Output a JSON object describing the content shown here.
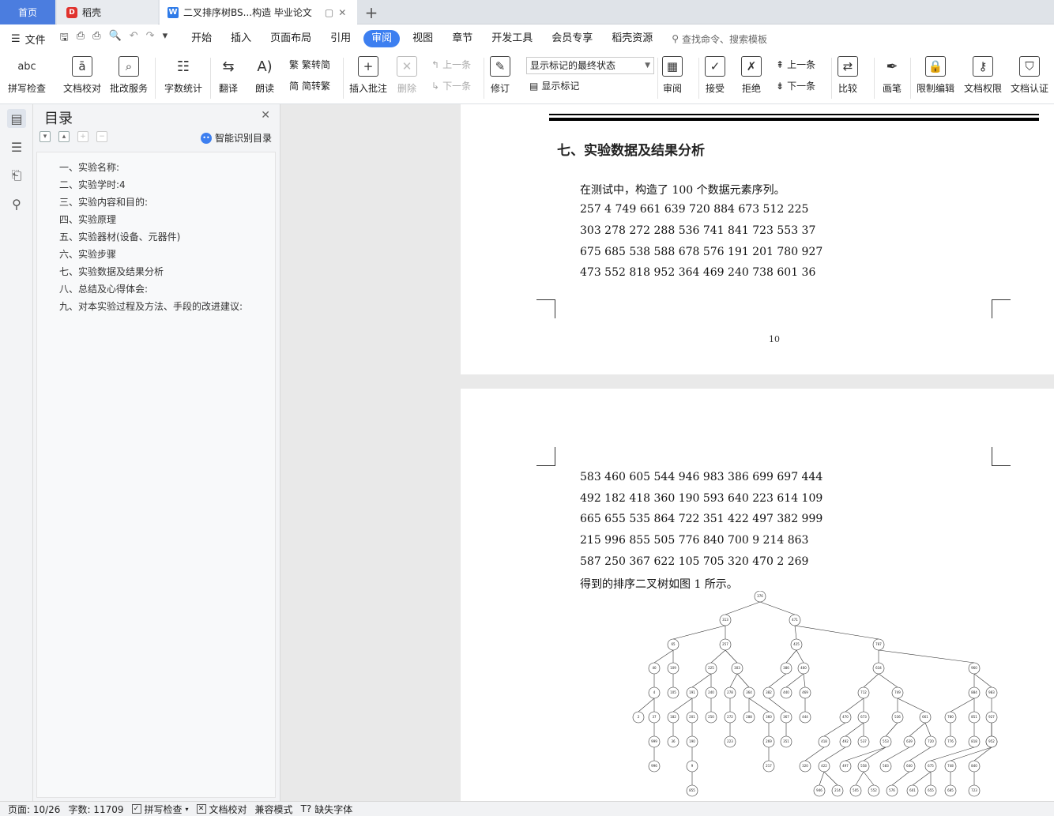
{
  "tabs": {
    "home": "首页",
    "daoke": "稻壳",
    "doc": "二叉排序树BS...构造 毕业论文"
  },
  "menubar": {
    "file": "文件",
    "items": [
      "开始",
      "插入",
      "页面布局",
      "引用",
      "审阅",
      "视图",
      "章节",
      "开发工具",
      "会员专享",
      "稻壳资源"
    ],
    "active": "审阅",
    "search": "查找命令、搜索模板"
  },
  "ribbon": {
    "spell": "拼写检查",
    "proof": "文档校对",
    "revise_service": "批改服务",
    "word_count": "字数统计",
    "translate": "翻译",
    "read_aloud": "朗读",
    "to_trad": "繁转简",
    "to_simp": "简转繁",
    "insert_comment": "插入批注",
    "delete": "删除",
    "prev_comment": "上一条",
    "next_comment": "下一条",
    "track": "修订",
    "display_state": "显示标记的最终状态",
    "show_markup": "显示标记",
    "review": "审阅",
    "accept": "接受",
    "reject": "拒绝",
    "prev_change": "上一条",
    "next_change": "下一条",
    "compare": "比较",
    "pen": "画笔",
    "restrict": "限制编辑",
    "permission": "文档权限",
    "certify": "文档认证"
  },
  "toc": {
    "title": "目录",
    "smart": "智能识别目录",
    "items": [
      "一、实验名称:",
      "二、实验学时:4",
      "三、实验内容和目的:",
      "四、实验原理",
      "五、实验器材(设备、元器件)",
      "六、实验步骤",
      "七、实验数据及结果分析",
      "八、总结及心得体会:",
      "九、对本实验过程及方法、手段的改进建议:"
    ]
  },
  "page1": {
    "heading": "七、实验数据及结果分析",
    "lines": [
      "在测试中，构造了 100 个数据元素序列。",
      "257 4 749 661 639 720 884 673 512 225",
      "303 278 272 288 536 741 841 723 553 37",
      "675 685 538 588 678 576 191 201 780 927",
      "473 552 818 952 364 469 240 738 601 36"
    ],
    "page_number": "10"
  },
  "page2": {
    "lines": [
      "583 460 605 544 946 983 386 699 697 444",
      "492 182 418 360 190 593 640 223 614 109",
      "665 655 535 864 722 351 422 497 382 999",
      "215 996 855 505 776 840 700 9 214 863",
      "587 250 367 622 105 705 320 470 2 269",
      "得到的排序二叉树如图 1 所示。"
    ]
  },
  "tree_nodes": [
    "376",
    "313",
    "471",
    "65",
    "257",
    "425",
    "787",
    "40",
    "109",
    "225",
    "303",
    "386",
    "460",
    "634",
    "960",
    "4",
    "105",
    "191",
    "240",
    "278",
    "364",
    "382",
    "440",
    "469",
    "712",
    "749",
    "884",
    "983",
    "2",
    "37",
    "182",
    "201",
    "250",
    "272",
    "288",
    "360",
    "367",
    "444",
    "470",
    "673",
    "536",
    "661",
    "780",
    "851",
    "927",
    "999",
    "36",
    "190",
    "223",
    "269",
    "351",
    "418",
    "492",
    "537",
    "553",
    "639",
    "720",
    "776",
    "818",
    "864",
    "952",
    "996",
    "9",
    "217",
    "320",
    "422",
    "497",
    "558",
    "583",
    "640",
    "675",
    "748",
    "840",
    "855",
    "946",
    "214",
    "505",
    "552",
    "576",
    "601",
    "655",
    "685",
    "723",
    "863"
  ],
  "status": {
    "page": "页面: 10/26",
    "words": "字数: 11709",
    "spell": "拼写检查",
    "proof": "文档校对",
    "compat": "兼容模式",
    "missing_font": "缺失字体"
  }
}
